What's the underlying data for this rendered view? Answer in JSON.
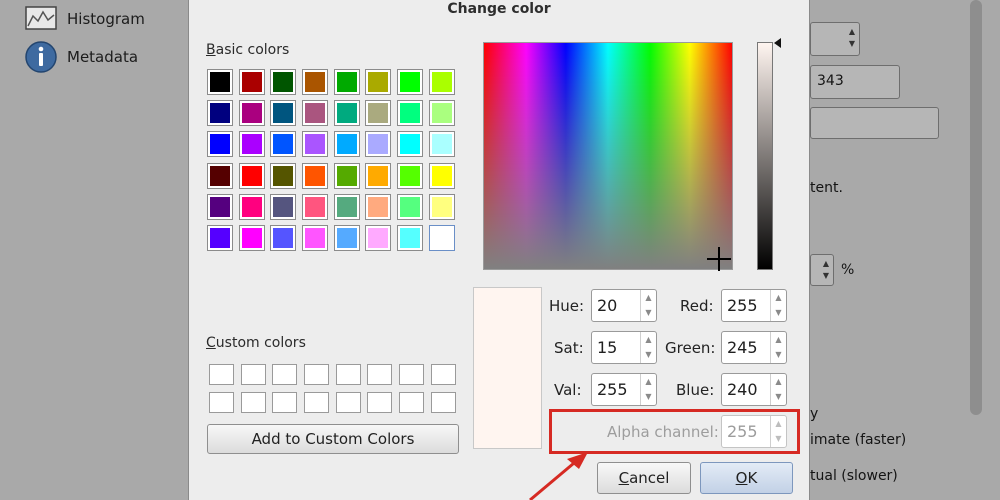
{
  "background": {
    "sidebar_items": [
      {
        "label": "Histogram",
        "icon": "histogram-icon"
      },
      {
        "label": "Metadata",
        "icon": "info-icon"
      }
    ],
    "right_texts": [
      "343",
      "tent.",
      "%",
      "y",
      "imate (faster)",
      "tual (slower)"
    ]
  },
  "dialog": {
    "title": "Change color",
    "basic_colors_label": "Basic colors",
    "custom_colors_label": "Custom colors",
    "add_custom_button": "Add to Custom Colors",
    "basic_colors": [
      "#000000",
      "#aa0000",
      "#005500",
      "#aa5500",
      "#00aa00",
      "#aaaa00",
      "#00ff00",
      "#aaff00",
      "#00007f",
      "#aa007f",
      "#00557f",
      "#aa557f",
      "#00aa7f",
      "#aaaa7f",
      "#00ff7f",
      "#aaff7f",
      "#0000ff",
      "#aa00ff",
      "#0055ff",
      "#aa55ff",
      "#00aaff",
      "#aaaaff",
      "#00ffff",
      "#aaffff",
      "#550000",
      "#ff0000",
      "#555500",
      "#ff5500",
      "#55aa00",
      "#ffaa00",
      "#55ff00",
      "#ffff00",
      "#55007f",
      "#ff007f",
      "#55557f",
      "#ff557f",
      "#55aa7f",
      "#ffaa7f",
      "#55ff7f",
      "#ffff7f",
      "#5500ff",
      "#ff00ff",
      "#5555ff",
      "#ff55ff",
      "#55aaff",
      "#ffaaff",
      "#55ffff",
      "#ffffff"
    ],
    "selected_color": "#fff5f0",
    "fields": {
      "hue": {
        "label": "Hue:",
        "value": "20"
      },
      "sat": {
        "label": "Sat:",
        "value": "15"
      },
      "val": {
        "label": "Val:",
        "value": "255"
      },
      "red": {
        "label": "Red:",
        "value": "255"
      },
      "green": {
        "label": "Green:",
        "value": "245"
      },
      "blue": {
        "label": "Blue:",
        "value": "240"
      },
      "alpha": {
        "label": "Alpha channel:",
        "value": "255"
      }
    },
    "cancel_button": "Cancel",
    "ok_button": "OK",
    "highlight_color": "#d62a23"
  }
}
